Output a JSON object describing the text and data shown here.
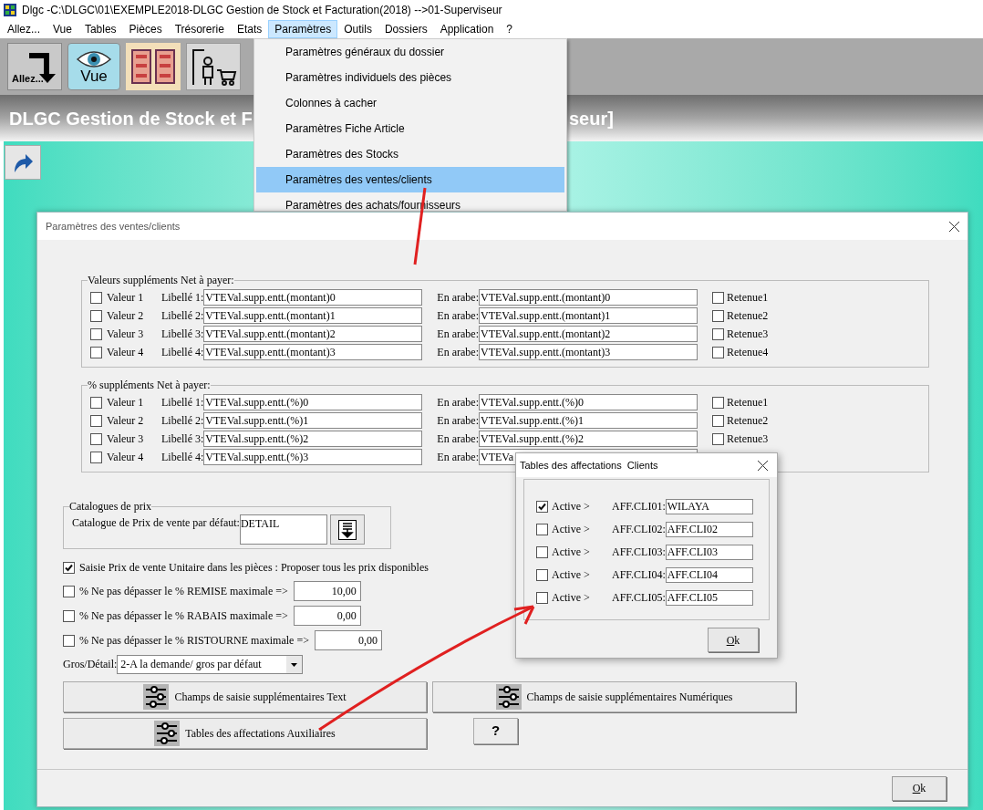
{
  "window": {
    "title": "Dlgc -C:\\DLGC\\01\\EXEMPLE2018-DLGC Gestion de Stock et Facturation(2018) -->01-Superviseur"
  },
  "menu_bar": [
    {
      "label": "Allez...",
      "selected": false
    },
    {
      "label": "Vue",
      "selected": false
    },
    {
      "label": "Tables",
      "selected": false
    },
    {
      "label": "Pièces",
      "selected": false
    },
    {
      "label": "Trésorerie",
      "selected": false
    },
    {
      "label": "Etats",
      "selected": false
    },
    {
      "label": "Paramètres",
      "selected": true
    },
    {
      "label": "Outils",
      "selected": false
    },
    {
      "label": "Dossiers",
      "selected": false
    },
    {
      "label": "Application",
      "selected": false
    },
    {
      "label": "?",
      "selected": false
    }
  ],
  "toolbar": [
    {
      "kind": "goto",
      "label": "Allez..."
    },
    {
      "kind": "view",
      "label": "Vue"
    },
    {
      "kind": "grid"
    },
    {
      "kind": "person"
    }
  ],
  "banner": {
    "text_before": "DLGC Gestion de Stock et F",
    "text_after": "seur]"
  },
  "dropdown_menu": [
    {
      "label": "Paramètres généraux du dossier",
      "selected": false
    },
    {
      "label": "Paramètres individuels des pièces",
      "selected": false
    },
    {
      "label": "Colonnes à cacher",
      "selected": false
    },
    {
      "label": "Paramètres Fiche Article",
      "selected": false
    },
    {
      "label": "Paramètres des Stocks",
      "selected": false
    },
    {
      "label": "Paramètres des ventes/clients",
      "selected": true
    },
    {
      "label": "Paramètres des achats/fournisseurs",
      "selected": false
    }
  ],
  "dialog": {
    "title": "Paramètres des ventes/clients",
    "groups": [
      {
        "legend": "Valeurs suppléments Net à payer:",
        "rows": [
          {
            "checked": false,
            "label": "Valeur 1",
            "libelle_label": "Libellé 1:",
            "libelle_value": "VTEVal.supp.entt.(montant)0",
            "arabic_label": "En arabe:",
            "arabic_value": "VTEVal.supp.entt.(montant)0",
            "retenue_label": "Retenue1",
            "retenue_checked": false
          },
          {
            "checked": false,
            "label": "Valeur 2",
            "libelle_label": "Libellé 2:",
            "libelle_value": "VTEVal.supp.entt.(montant)1",
            "arabic_label": "En arabe:",
            "arabic_value": "VTEVal.supp.entt.(montant)1",
            "retenue_label": "Retenue2",
            "retenue_checked": false
          },
          {
            "checked": false,
            "label": "Valeur 3",
            "libelle_label": "Libellé 3:",
            "libelle_value": "VTEVal.supp.entt.(montant)2",
            "arabic_label": "En arabe:",
            "arabic_value": "VTEVal.supp.entt.(montant)2",
            "retenue_label": "Retenue3",
            "retenue_checked": false
          },
          {
            "checked": false,
            "label": "Valeur 4",
            "libelle_label": "Libellé 4:",
            "libelle_value": "VTEVal.supp.entt.(montant)3",
            "arabic_label": "En arabe:",
            "arabic_value": "VTEVal.supp.entt.(montant)3",
            "retenue_label": "Retenue4",
            "retenue_checked": false
          }
        ]
      },
      {
        "legend": "% suppléments Net à payer:",
        "rows": [
          {
            "checked": false,
            "label": "Valeur 1",
            "libelle_label": "Libellé 1:",
            "libelle_value": "VTEVal.supp.entt.(%)0",
            "arabic_label": "En arabe:",
            "arabic_value": "VTEVal.supp.entt.(%)0",
            "retenue_label": "Retenue1",
            "retenue_checked": false
          },
          {
            "checked": false,
            "label": "Valeur 2",
            "libelle_label": "Libellé 2:",
            "libelle_value": "VTEVal.supp.entt.(%)1",
            "arabic_label": "En arabe:",
            "arabic_value": "VTEVal.supp.entt.(%)1",
            "retenue_label": "Retenue2",
            "retenue_checked": false
          },
          {
            "checked": false,
            "label": "Valeur 3",
            "libelle_label": "Libellé 3:",
            "libelle_value": "VTEVal.supp.entt.(%)2",
            "arabic_label": "En arabe:",
            "arabic_value": "VTEVal.supp.entt.(%)2",
            "retenue_label": "Retenue3",
            "retenue_checked": false
          },
          {
            "checked": false,
            "label": "Valeur 4",
            "libelle_label": "Libellé 4:",
            "libelle_value": "VTEVal.supp.entt.(%)3",
            "arabic_label": "En arabe:",
            "arabic_value": "VTEVa"
          }
        ]
      }
    ],
    "catalog": {
      "legend": "Catalogues de prix",
      "label": "Catalogue de Prix de vente par défaut:",
      "value": "DETAIL"
    },
    "price_option": {
      "checked": true,
      "label": "Saisie Prix de vente Unitaire dans les pièces : Proposer tous les prix disponibles"
    },
    "limits": [
      {
        "checked": false,
        "label": "% Ne pas dépasser le % REMISE maximale =>",
        "value": "10,00"
      },
      {
        "checked": false,
        "label": "% Ne pas dépasser le % RABAIS maximale =>",
        "value": "0,00"
      },
      {
        "checked": false,
        "label": "% Ne pas dépasser le % RISTOURNE maximale =>",
        "value": "0,00"
      }
    ],
    "gros_detail": {
      "label": "Gros/Détail:",
      "value": "2-A la demande/ gros par défaut"
    },
    "buttons": [
      {
        "kind": "icon",
        "label": "Champs de saisie supplémentaires Text"
      },
      {
        "kind": "icon",
        "label": "Champs de saisie supplémentaires Numériques"
      },
      {
        "kind": "icon",
        "label": "Tables des affectations Auxiliaires"
      },
      {
        "kind": "plain",
        "label": "?"
      }
    ],
    "ok": "Ok"
  },
  "sub_dialog": {
    "title": "Tables des affectations  Clients",
    "rows": [
      {
        "checked": true,
        "label": "Active >",
        "code": "AFF.CLI01:",
        "value": "WILAYA"
      },
      {
        "checked": false,
        "label": "Active >",
        "code": "AFF.CLI02:",
        "value": "AFF.CLI02"
      },
      {
        "checked": false,
        "label": "Active >",
        "code": "AFF.CLI03:",
        "value": "AFF.CLI03"
      },
      {
        "checked": false,
        "label": "Active >",
        "code": "AFF.CLI04:",
        "value": "AFF.CLI04"
      },
      {
        "checked": false,
        "label": "Active >",
        "code": "AFF.CLI05:",
        "value": "AFF.CLI05"
      }
    ],
    "ok": "Ok"
  }
}
